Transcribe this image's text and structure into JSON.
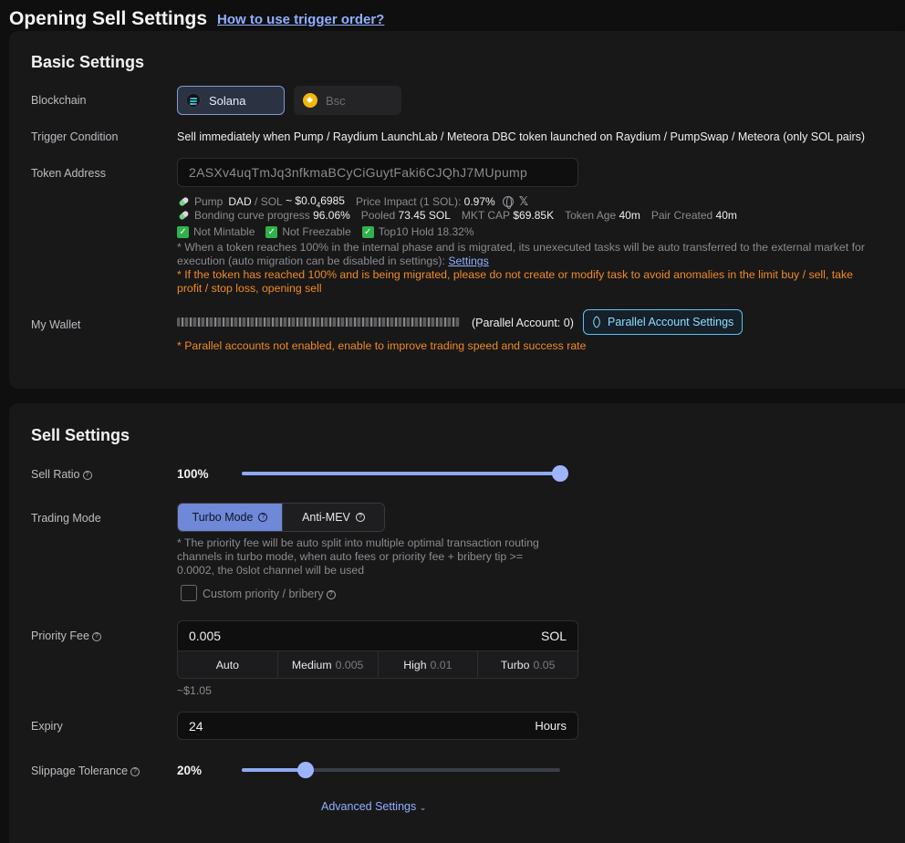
{
  "header": {
    "title": "Opening Sell Settings",
    "help_link": "How to use trigger order?"
  },
  "basic": {
    "title": "Basic Settings",
    "blockchain_label": "Blockchain",
    "chains": [
      {
        "label": "Solana",
        "icon": "solana-icon",
        "selected": true
      },
      {
        "label": "Bsc",
        "icon": "bsc-icon",
        "selected": false
      }
    ],
    "trigger_label": "Trigger Condition",
    "trigger_text": "Sell immediately when Pump / Raydium LaunchLab / Meteora DBC token launched on Raydium / PumpSwap / Meteora (only SOL pairs)",
    "token_label": "Token Address",
    "token_address": "2ASXv4uqTmJq3nfkmaBCyCiGuytFaki6CJQhJ7MUpump",
    "info": {
      "platform": "Pump",
      "symbol": "DAD",
      "pair_sep": "/ SOL",
      "price_prefix": "~ $0.0",
      "price_sub": "4",
      "price_rest": "6985",
      "impact_label": "Price Impact (1 SOL):",
      "impact_value": "0.97%",
      "progress_label": "Bonding curve progress",
      "progress_value": "96.06%",
      "pooled_label": "Pooled",
      "pooled_value": "73.45 SOL",
      "mcap_label": "MKT CAP",
      "mcap_value": "$69.85K",
      "age_label": "Token Age",
      "age_value": "40m",
      "pair_label": "Pair Created",
      "pair_value": "40m",
      "check1": "Not Mintable",
      "check2": "Not Freezable",
      "check3_label": "Top10 Hold",
      "check3_value": "18.32%"
    },
    "note_gray_1": "* When a token reaches 100% in the internal phase and is migrated, its unexecuted tasks will be auto transferred to the external market for",
    "note_gray_2": "execution (auto migration can be disabled in settings):",
    "note_settings_link": "Settings",
    "note_orange_1": "* If the token has reached 100% and is being migrated, please do not create or modify task to avoid anomalies in the limit buy / sell, take",
    "note_orange_2": "profit / stop loss, opening sell",
    "wallet_label": "My Wallet",
    "parallel_count": "(Parallel Account: 0)",
    "parallel_button": "Parallel Account Settings",
    "parallel_note": "* Parallel accounts not enabled, enable to improve trading speed and success rate"
  },
  "sell": {
    "title": "Sell Settings",
    "ratio_label": "Sell Ratio",
    "ratio_value": "100%",
    "ratio_fraction": 1.0,
    "mode_label": "Trading Mode",
    "modes": [
      {
        "label": "Turbo Mode",
        "selected": true
      },
      {
        "label": "Anti-MEV",
        "selected": false
      }
    ],
    "mode_note_1": "* The priority fee will be auto split into multiple optimal transaction routing",
    "mode_note_2": "channels in turbo mode, when auto fees or priority fee + bribery tip >=",
    "mode_note_3": "0.0002, the 0slot channel will be used",
    "custom_label": "Custom priority / bribery",
    "fee_label": "Priority Fee",
    "fee_value": "0.005",
    "fee_unit": "SOL",
    "fee_tabs": [
      {
        "label": "Auto",
        "sub": ""
      },
      {
        "label": "Medium",
        "sub": "0.005"
      },
      {
        "label": "High",
        "sub": "0.01"
      },
      {
        "label": "Turbo",
        "sub": "0.05"
      }
    ],
    "fee_usd": "~$1.05",
    "expiry_label": "Expiry",
    "expiry_value": "24",
    "expiry_unit": "Hours",
    "slippage_label": "Slippage Tolerance",
    "slippage_value": "20%",
    "slippage_fraction": 0.2,
    "advanced": "Advanced Settings"
  },
  "colors": {
    "accent": "#8fb0ff",
    "warning": "#f08a24",
    "panel": "#181819",
    "background": "#0f0f10"
  }
}
